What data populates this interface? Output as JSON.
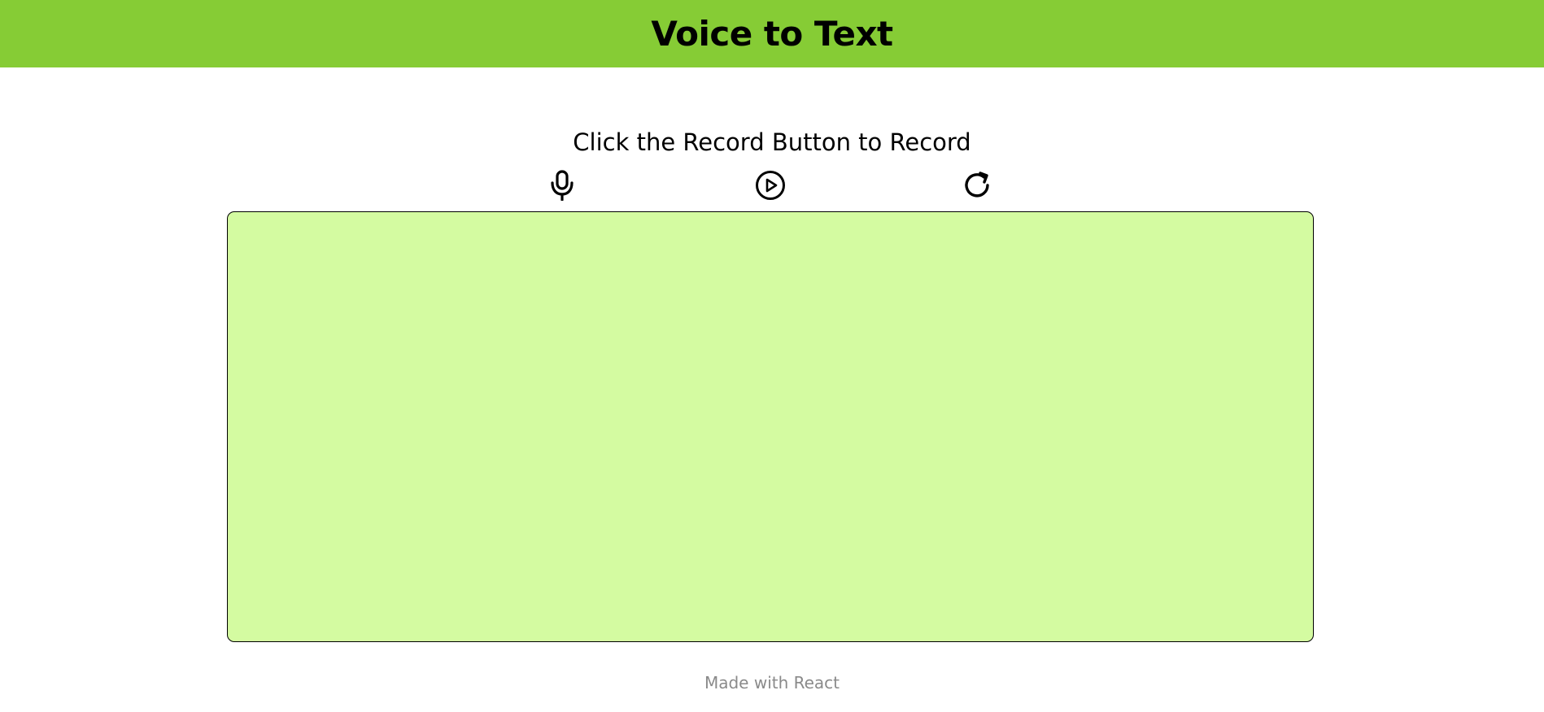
{
  "header": {
    "title": "Voice to Text",
    "background_color": "#86cc35"
  },
  "main": {
    "instruction": "Click the Record Button to Record",
    "controls": [
      {
        "name": "record",
        "icon": "microphone-icon"
      },
      {
        "name": "play",
        "icon": "play-circle-icon"
      },
      {
        "name": "reset",
        "icon": "refresh-icon"
      }
    ],
    "transcript": {
      "value": "",
      "background_color": "#d4fba1"
    }
  },
  "footer": {
    "text": "Made with React"
  }
}
